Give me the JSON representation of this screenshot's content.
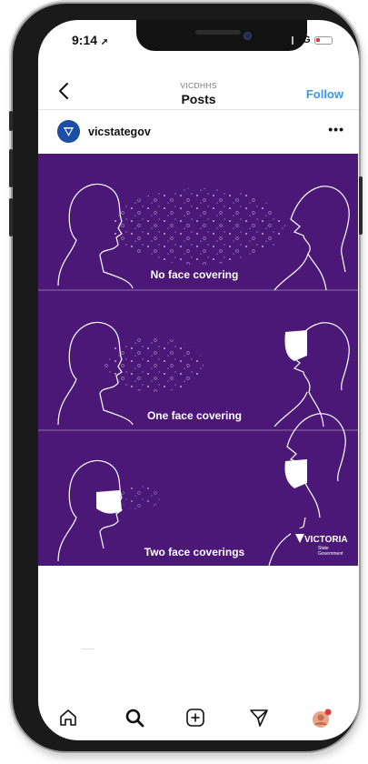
{
  "status_bar": {
    "time": "9:14",
    "network": "4G"
  },
  "header": {
    "account": "VICDHHS",
    "title": "Posts",
    "follow_label": "Follow"
  },
  "post": {
    "username": "vicstategov",
    "more_label": "•••",
    "image": {
      "background": "#4b1878",
      "panels": [
        {
          "label": "No face covering"
        },
        {
          "label": "One face covering"
        },
        {
          "label": "Two face coverings"
        }
      ],
      "brand": {
        "name": "VICTORIA",
        "line1": "State",
        "line2": "Government"
      }
    }
  },
  "tabbar": {
    "icons": [
      "home-icon",
      "search-icon",
      "new-post-icon",
      "direct-message-icon",
      "profile-avatar"
    ]
  },
  "colors": {
    "accent": "#3897f0",
    "purple": "#4b1878",
    "notification": "#e53935"
  }
}
